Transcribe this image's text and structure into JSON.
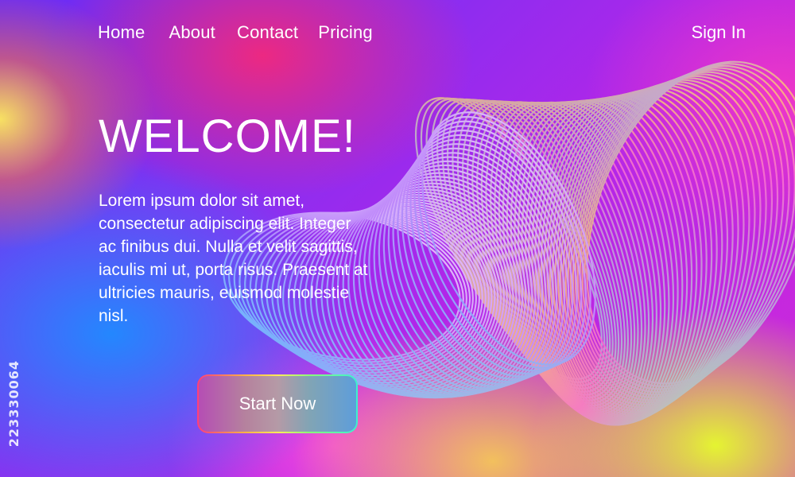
{
  "nav": {
    "items": [
      {
        "label": "Home"
      },
      {
        "label": "About"
      },
      {
        "label": "Contact"
      },
      {
        "label": "Pricing"
      }
    ],
    "signin_label": "Sign In"
  },
  "hero": {
    "title": "WELCOME!",
    "body": "Lorem ipsum dolor sit amet, consectetur adipiscing elit. Integer ac finibus dui. Nulla et velit sagittis, iaculis mi ut, porta risus. Praesent at ultricies mauris, euismod molestie nisl.",
    "cta_label": "Start Now"
  },
  "watermark": {
    "stock_id": "223330064"
  },
  "colors": {
    "background_base": "#8b2df0",
    "accent_pink": "#ff2d78",
    "accent_blue": "#1e8cff",
    "accent_yellow": "#e6ff28",
    "text": "#ffffff"
  }
}
